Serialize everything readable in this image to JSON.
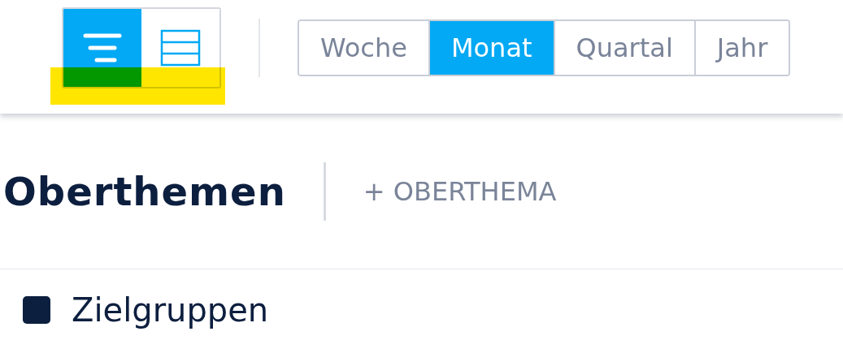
{
  "view_toggle": [
    {
      "kind": "list",
      "selected": true
    },
    {
      "kind": "rows",
      "selected": false
    }
  ],
  "toggle_highlight": true,
  "periods": [
    {
      "label": "Woche",
      "selected": false
    },
    {
      "label": "Monat",
      "selected": true
    },
    {
      "label": "Quartal",
      "selected": false
    },
    {
      "label": "Jahr",
      "selected": false
    }
  ],
  "section": {
    "title": "Oberthemen",
    "add_button": "+ OBERTHEMA"
  },
  "topics": [
    {
      "label": "Zielgruppen"
    }
  ]
}
